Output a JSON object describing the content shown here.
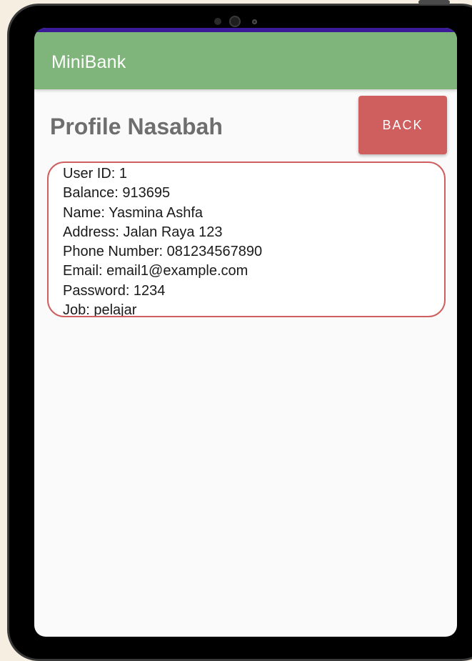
{
  "app": {
    "title": "MiniBank"
  },
  "page": {
    "title": "Profile Nasabah",
    "back_label": "BACK"
  },
  "profile": {
    "lines": [
      "User ID: 1",
      "Balance: 913695",
      "Name: Yasmina Ashfa",
      "Address: Jalan Raya 123",
      "Phone Number: 081234567890",
      "Email: email1@example.com",
      "Password: 1234",
      "Job: pelajar"
    ]
  },
  "colors": {
    "appbar": "#7fb47a",
    "status_bar": "#3b1a9a",
    "accent": "#cf5f5e",
    "page_background": "#fafafa"
  }
}
